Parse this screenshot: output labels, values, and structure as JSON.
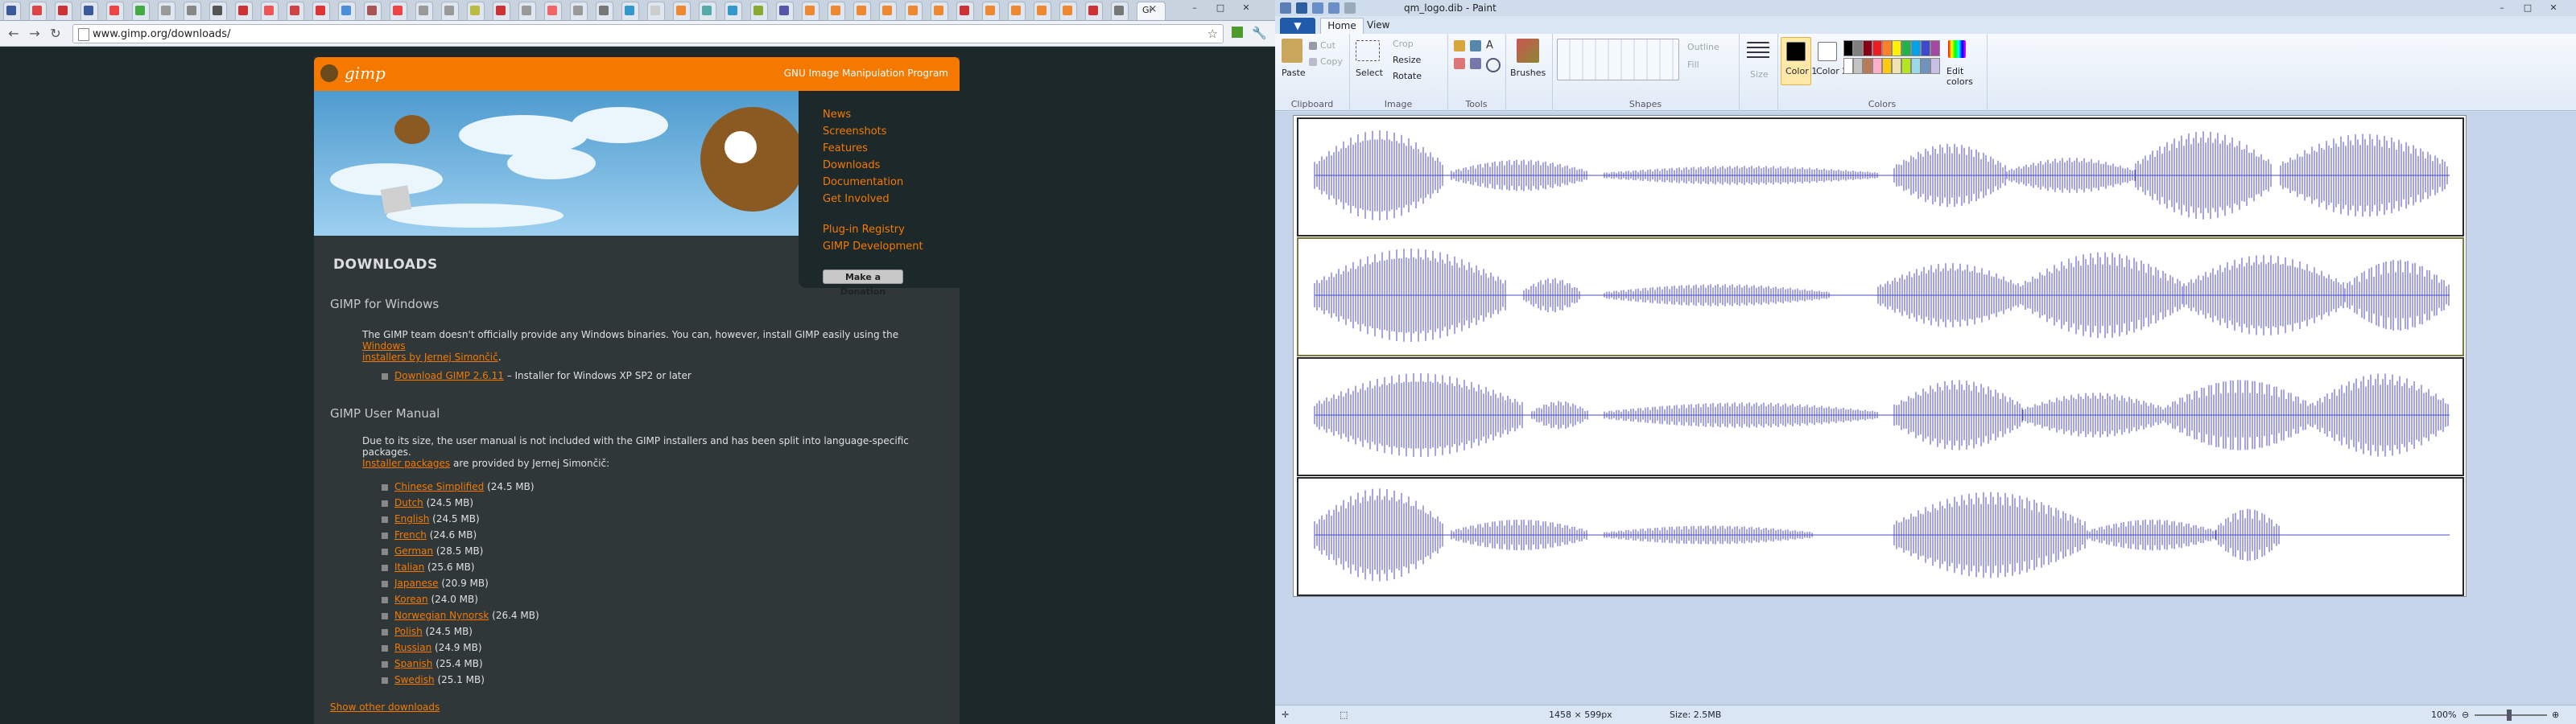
{
  "browser": {
    "url": "www.gimp.org/downloads/",
    "tab_label": "Gi",
    "tab_colors": [
      "#3b5998",
      "#d44",
      "#c33",
      "#3b5998",
      "#e44",
      "#4a4",
      "#999",
      "#888",
      "#555",
      "#c33",
      "#e55",
      "#c44",
      "#d33",
      "#4a90d9",
      "#a55",
      "#e44",
      "#999",
      "#999",
      "#bb4",
      "#cc3333",
      "#999",
      "#e66",
      "#999",
      "#777",
      "#39c",
      "#ccc",
      "#e83",
      "#5aa",
      "#39c",
      "#8a3",
      "#55a",
      "#e83",
      "#e83",
      "#e83",
      "#e83",
      "#e83",
      "#e83",
      "#c33",
      "#e83",
      "#e83",
      "#e83",
      "#e83",
      "#c33",
      "#777"
    ]
  },
  "gimp": {
    "logo_text": "gimp",
    "tagline": "GNU Image Manipulation Program",
    "nav": [
      "News",
      "Screenshots",
      "Features",
      "Downloads",
      "Documentation",
      "Get Involved"
    ],
    "nav2": [
      "Plug-in Registry",
      "GIMP Development"
    ],
    "donate": "Make a Donation",
    "title": "DOWNLOADS",
    "win_heading": "GIMP for Windows",
    "win_text_1": "The GIMP team doesn't officially provide any Windows binaries. You can, however, install GIMP easily using the",
    "win_link_a": "Windows",
    "win_link_b": "installers by Jernej Simončič",
    "win_dl_link": "Download GIMP 2.6.11",
    "win_dl_rest": " – Installer for Windows XP SP2 or later",
    "manual_heading": "GIMP User Manual",
    "manual_text_1": "Due to its size, the user manual is not included with the GIMP installers and has been split into language-specific packages.",
    "manual_link": "Installer packages",
    "manual_text_2": " are provided by Jernej Simončič:",
    "packages": [
      {
        "lang": "Chinese Simplified",
        "size": " (24.5 MB)"
      },
      {
        "lang": "Dutch",
        "size": " (24.5 MB)"
      },
      {
        "lang": "English",
        "size": " (24.5 MB)"
      },
      {
        "lang": "French",
        "size": " (24.6 MB)"
      },
      {
        "lang": "German",
        "size": " (28.5 MB)"
      },
      {
        "lang": "Italian",
        "size": " (25.6 MB)"
      },
      {
        "lang": "Japanese",
        "size": " (20.9 MB)"
      },
      {
        "lang": "Korean",
        "size": " (24.0 MB)"
      },
      {
        "lang": "Norwegian Nynorsk",
        "size": " (26.4 MB)"
      },
      {
        "lang": "Polish",
        "size": " (24.5 MB)"
      },
      {
        "lang": "Russian",
        "size": " (24.9 MB)"
      },
      {
        "lang": "Spanish",
        "size": " (25.4 MB)"
      },
      {
        "lang": "Swedish",
        "size": " (25.1 MB)"
      }
    ],
    "show_other": "Show other downloads"
  },
  "paint": {
    "title": "qm_logo.dib - Paint",
    "file_menu": "▼",
    "tabs": [
      "Home",
      "View"
    ],
    "clipboard": {
      "paste": "Paste",
      "cut": "Cut",
      "copy": "Copy",
      "label": "Clipboard"
    },
    "image": {
      "select": "Select",
      "crop": "Crop",
      "resize": "Resize",
      "rotate": "Rotate",
      "label": "Image"
    },
    "tools_label": "Tools",
    "brushes": "Brushes",
    "shapes": {
      "outline": "Outline",
      "fill": "Fill",
      "label": "Shapes"
    },
    "size": "Size",
    "color1": "Color 1",
    "color2": "Color 2",
    "colors_label": "Colors",
    "edit_colors": "Edit colors",
    "palette_row1": [
      "#000000",
      "#7f7f7f",
      "#880015",
      "#ed1c24",
      "#ff7f27",
      "#fff200",
      "#22b14c",
      "#00a2e8",
      "#3f48cc",
      "#a349a4"
    ],
    "palette_row2": [
      "#ffffff",
      "#c3c3c3",
      "#b97a57",
      "#ffaec9",
      "#ffc90e",
      "#efe4b0",
      "#b5e61d",
      "#99d9ea",
      "#7092be",
      "#c8bfe7"
    ],
    "wave_color": "#4a4acc",
    "status": {
      "dims": "1458 × 599px",
      "size": "Size: 2.5MB",
      "zoom": "100%"
    }
  }
}
